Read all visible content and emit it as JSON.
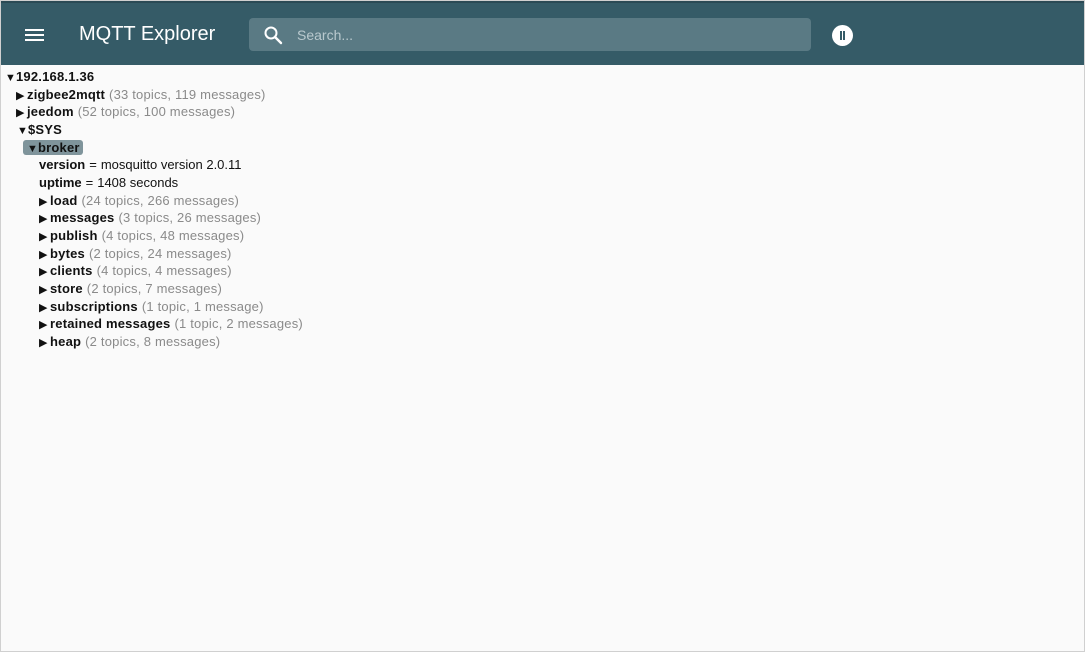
{
  "app": {
    "title": "MQTT Explorer",
    "search_placeholder": "Search...",
    "icons": {
      "menu": "menu-icon",
      "search": "search-icon",
      "pause": "pause-icon"
    },
    "colors": {
      "appbar": "#355b67",
      "search_bg": "#5a7a84",
      "selected_bg": "#7f949b"
    }
  },
  "tree": {
    "root": {
      "arrow": "▼",
      "name": "192.168.1.36"
    },
    "zigbee2mqtt": {
      "arrow": "▶",
      "name": "zigbee2mqtt",
      "meta": "(33 topics, 119 messages)"
    },
    "jeedom": {
      "arrow": "▶",
      "name": "jeedom",
      "meta": "(52 topics, 100 messages)"
    },
    "sys": {
      "arrow": "▼",
      "name": "$SYS"
    },
    "broker": {
      "arrow": "▼",
      "name": "broker"
    },
    "version": {
      "key": "version",
      "eq": "=",
      "value": "mosquitto version 2.0.11"
    },
    "uptime": {
      "key": "uptime",
      "eq": "=",
      "value": "1408 seconds"
    },
    "children": [
      {
        "arrow": "▶",
        "name": "load",
        "meta": "(24 topics, 266 messages)"
      },
      {
        "arrow": "▶",
        "name": "messages",
        "meta": "(3 topics, 26 messages)"
      },
      {
        "arrow": "▶",
        "name": "publish",
        "meta": "(4 topics, 48 messages)"
      },
      {
        "arrow": "▶",
        "name": "bytes",
        "meta": "(2 topics, 24 messages)"
      },
      {
        "arrow": "▶",
        "name": "clients",
        "meta": "(4 topics, 4 messages)"
      },
      {
        "arrow": "▶",
        "name": "store",
        "meta": "(2 topics, 7 messages)"
      },
      {
        "arrow": "▶",
        "name": "subscriptions",
        "meta": "(1 topic, 1 message)"
      },
      {
        "arrow": "▶",
        "name": "retained messages",
        "meta": "(1 topic, 2 messages)"
      },
      {
        "arrow": "▶",
        "name": "heap",
        "meta": "(2 topics, 8 messages)"
      }
    ]
  }
}
